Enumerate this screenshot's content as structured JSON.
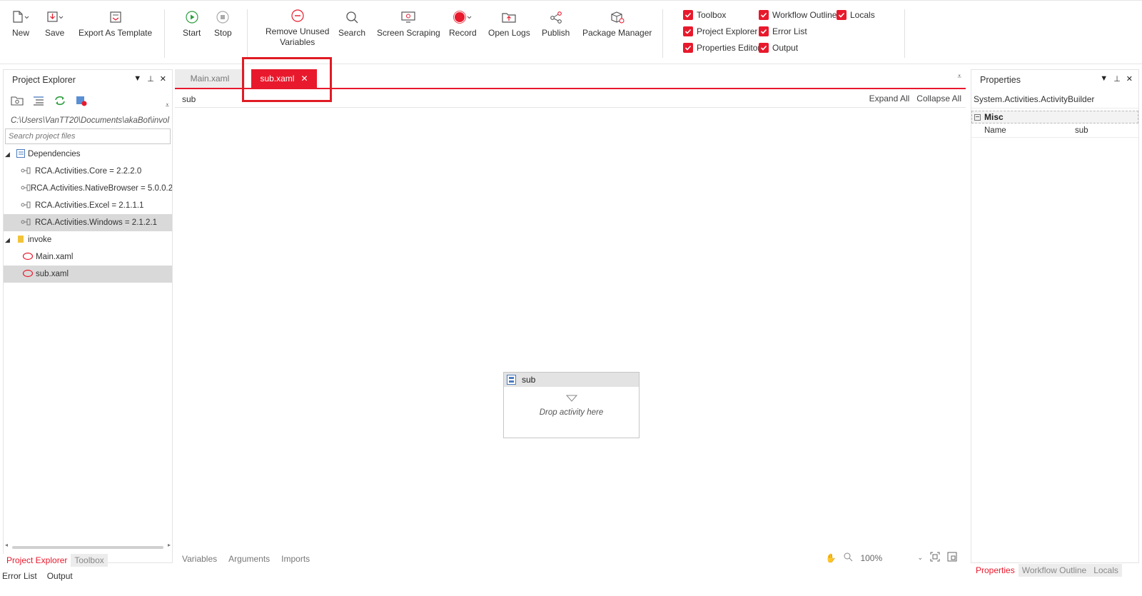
{
  "ribbon": {
    "new_label": "New",
    "save_label": "Save",
    "export_label": "Export As Template",
    "start_label": "Start",
    "stop_label": "Stop",
    "remove_unused_line1": "Remove Unused",
    "remove_unused_line2": "Variables",
    "search_label": "Search",
    "screen_scraping_label": "Screen Scraping",
    "record_label": "Record",
    "open_logs_label": "Open Logs",
    "publish_label": "Publish",
    "package_manager_label": "Package Manager"
  },
  "panel_toggles": {
    "toolbox": "Toolbox",
    "workflow_outline": "Workflow Outline",
    "locals": "Locals",
    "project_explorer": "Project Explorer",
    "error_list": "Error List",
    "properties_editor": "Properties Editor",
    "output": "Output"
  },
  "project_explorer": {
    "title": "Project Explorer",
    "path": "C:\\Users\\VanTT20\\Documents\\akaBot\\invol",
    "search_placeholder": "Search project files",
    "dependencies_label": "Dependencies",
    "dependencies": [
      "RCA.Activities.Core = 2.2.2.0",
      "RCA.Activities.NativeBrowser = 5.0.0.2",
      "RCA.Activities.Excel = 2.1.1.1",
      "RCA.Activities.Windows = 2.1.2.1"
    ],
    "folder_label": "invoke",
    "files": [
      "Main.xaml",
      "sub.xaml"
    ]
  },
  "left_tabs": {
    "project_explorer": "Project Explorer",
    "toolbox": "Toolbox"
  },
  "bottom_tabs": {
    "error_list": "Error List",
    "output": "Output"
  },
  "document": {
    "tabs": [
      "Main.xaml",
      "sub.xaml"
    ],
    "close_glyph": "✕",
    "breadcrumb": "sub",
    "expand_all": "Expand All",
    "collapse_all": "Collapse All",
    "activity_title": "sub",
    "drop_hint": "Drop activity here",
    "bottom_tabs": [
      "Variables",
      "Arguments",
      "Imports"
    ],
    "zoom": "100%"
  },
  "properties": {
    "title": "Properties",
    "type_name": "System.Activities.ActivityBuilder",
    "category": "Misc",
    "name_label": "Name",
    "name_value": "sub"
  },
  "right_tabs": {
    "properties": "Properties",
    "workflow_outline": "Workflow Outline",
    "locals": "Locals"
  },
  "colors": {
    "accent": "#e8192c",
    "highlight_box": "#e01b24"
  }
}
